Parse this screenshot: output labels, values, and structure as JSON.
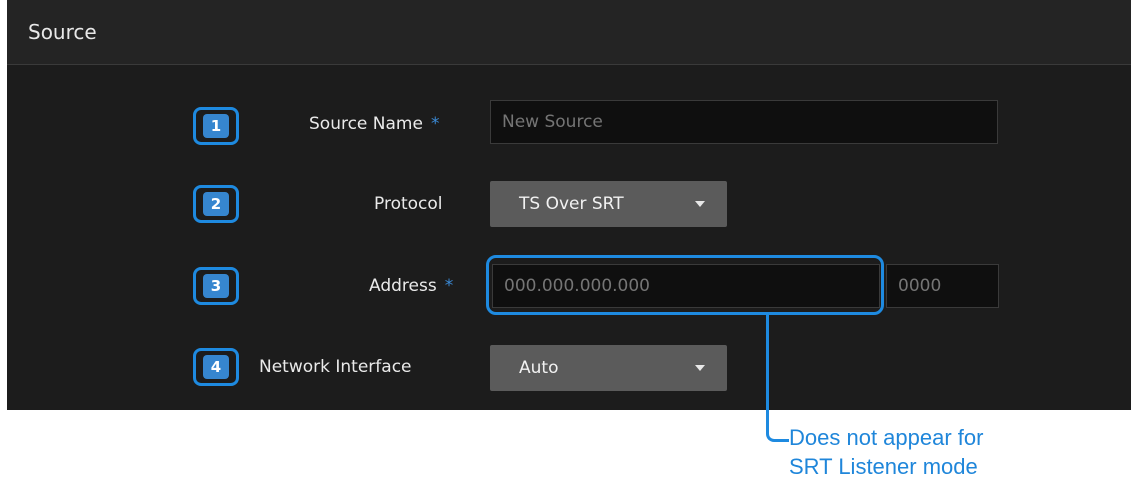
{
  "panel": {
    "title": "Source"
  },
  "rows": [
    {
      "number": "1",
      "label": "Source Name",
      "required": "*",
      "placeholder": "New Source"
    },
    {
      "number": "2",
      "label": "Protocol",
      "selected": "TS Over SRT"
    },
    {
      "number": "3",
      "label": "Address",
      "required": "*",
      "address_placeholder": "000.000.000.000",
      "port_placeholder": "0000"
    },
    {
      "number": "4",
      "label": "Network Interface",
      "selected": "Auto"
    }
  ],
  "callout": {
    "line1": "Does not appear for",
    "line2": "SRT Listener mode"
  },
  "colors": {
    "accent": "#1e8ae0",
    "panel_bg": "#1c1c1c",
    "dropdown_bg": "#5b5b5b"
  },
  "icons": {
    "dropdown": "caret-down-icon"
  }
}
